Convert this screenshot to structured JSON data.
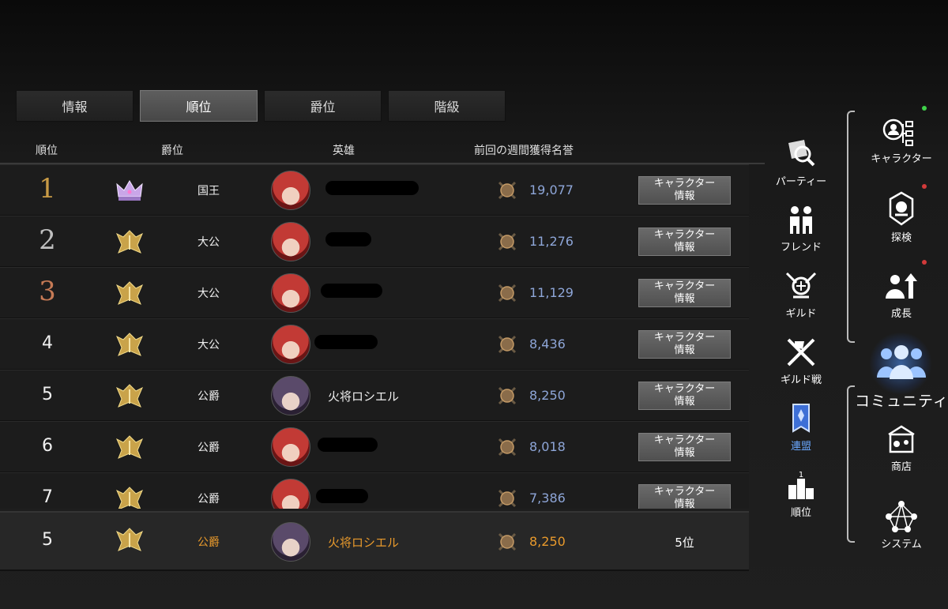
{
  "tabs": [
    "情報",
    "順位",
    "爵位",
    "階級"
  ],
  "active_tab": 1,
  "columns": {
    "rank": "順位",
    "title": "爵位",
    "hero": "英雄",
    "honor": "前回の週間獲得名誉"
  },
  "info_button_label": [
    "キャラクター",
    "情報"
  ],
  "rows": [
    {
      "rank": "1",
      "title": "国王",
      "name": "",
      "honor": "19,077",
      "emblem": "crown-icon"
    },
    {
      "rank": "2",
      "title": "大公",
      "name": "",
      "honor": "11,276",
      "emblem": "gold-crest-icon"
    },
    {
      "rank": "3",
      "title": "大公",
      "name": "",
      "honor": "11,129",
      "emblem": "gold-crest-icon"
    },
    {
      "rank": "4",
      "title": "大公",
      "name": "",
      "honor": "8,436",
      "emblem": "gold-crest-icon"
    },
    {
      "rank": "5",
      "title": "公爵",
      "name": "火将ロシエル",
      "honor": "8,250",
      "emblem": "gold-crest-icon"
    },
    {
      "rank": "6",
      "title": "公爵",
      "name": "",
      "honor": "8,018",
      "emblem": "gold-crest-icon"
    },
    {
      "rank": "7",
      "title": "公爵",
      "name": "",
      "honor": "7,386",
      "emblem": "gold-crest-icon"
    }
  ],
  "self_row": {
    "rank": "5",
    "title": "公爵",
    "name": "火将ロシエル",
    "honor": "8,250",
    "place": "5位"
  },
  "community_submenu": [
    {
      "label": "パーティー",
      "icon": "party-icon"
    },
    {
      "label": "フレンド",
      "icon": "friends-icon"
    },
    {
      "label": "ギルド",
      "icon": "guild-icon"
    },
    {
      "label": "ギルド戦",
      "icon": "guild-war-icon"
    },
    {
      "label": "連盟",
      "icon": "alliance-banner-icon"
    },
    {
      "label": "順位",
      "icon": "ranking-podium-icon"
    }
  ],
  "main_menu": [
    {
      "label": "キャラクター",
      "icon": "character-icon"
    },
    {
      "label": "探検",
      "icon": "exploration-icon"
    },
    {
      "label": "成長",
      "icon": "growth-icon"
    },
    {
      "label": "コミュニティ",
      "icon": "community-icon"
    },
    {
      "label": "商店",
      "icon": "shop-icon"
    },
    {
      "label": "システム",
      "icon": "system-icon"
    }
  ],
  "colors": {
    "accent_blue": "#6aa8ff",
    "self_orange": "#e99a2c",
    "honor_blue": "#8ea6d8",
    "dot_green": "#3fd24a",
    "dot_red": "#d23a3a"
  }
}
